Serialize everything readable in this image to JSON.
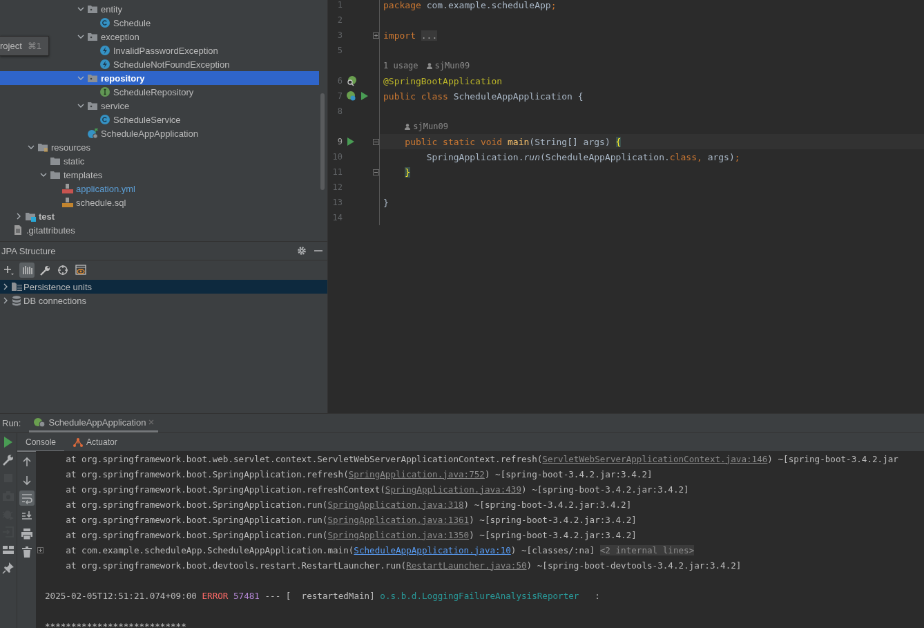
{
  "project_tree": {
    "tooltip": {
      "label": "roject",
      "shortcut": "⌘1"
    },
    "items": [
      {
        "children": [
          {
            "children": [
              {
                "children": [
                  {
                    "children": [
                      {
                        "children": [
                          {
                            "children": [
                              {
                                "label": "entity",
                                "kind": "package",
                                "expanded": true,
                                "selected": false,
                                "modified": false,
                                "children": [
                                  {
                                    "label": "Schedule",
                                    "kind": "class",
                                    "selected": false,
                                    "modified": false
                                  }
                                ]
                              },
                              {
                                "label": "exception",
                                "kind": "package",
                                "expanded": true,
                                "selected": false,
                                "modified": false,
                                "children": [
                                  {
                                    "label": "InvalidPasswordException",
                                    "kind": "exception",
                                    "selected": false,
                                    "modified": false
                                  },
                                  {
                                    "label": "ScheduleNotFoundException",
                                    "kind": "exception",
                                    "selected": false,
                                    "modified": false
                                  }
                                ]
                              },
                              {
                                "label": "repository",
                                "kind": "package",
                                "expanded": true,
                                "selected": true,
                                "modified": false,
                                "children": [
                                  {
                                    "label": "ScheduleRepository",
                                    "kind": "interface",
                                    "selected": false,
                                    "modified": false
                                  }
                                ]
                              },
                              {
                                "label": "service",
                                "kind": "package",
                                "expanded": true,
                                "selected": false,
                                "modified": false,
                                "children": [
                                  {
                                    "label": "ScheduleService",
                                    "kind": "class",
                                    "selected": false,
                                    "modified": false
                                  }
                                ]
                              },
                              {
                                "label": "ScheduleAppApplication",
                                "kind": "app",
                                "selected": false,
                                "modified": false
                              }
                            ]
                          }
                        ]
                      }
                    ]
                  }
                ]
              },
              {
                "label": "resources",
                "kind": "resources",
                "expanded": true,
                "selected": false,
                "modified": false,
                "children": [
                  {
                    "label": "static",
                    "kind": "folder",
                    "selected": false,
                    "modified": false
                  },
                  {
                    "label": "templates",
                    "kind": "folder",
                    "expanded": true,
                    "selected": false,
                    "modified": false,
                    "children": [
                      {
                        "label": "application.yml",
                        "kind": "yml",
                        "selected": false,
                        "modified": true
                      },
                      {
                        "label": "schedule.sql",
                        "kind": "sql",
                        "selected": false,
                        "modified": false
                      }
                    ]
                  }
                ]
              }
            ]
          },
          {
            "label": "test",
            "kind": "test-folder",
            "expanded": false,
            "selected": false,
            "modified": false
          }
        ]
      },
      {
        "label": ".gitattributes",
        "kind": "file",
        "selected": false,
        "modified": false
      }
    ]
  },
  "jpa_structure": {
    "title": "JPA Structure",
    "toolbar": [
      {
        "kind": "add",
        "on": false
      },
      {
        "kind": "columns",
        "on": true
      },
      {
        "kind": "wrench",
        "on": false
      },
      {
        "kind": "target",
        "on": false
      },
      {
        "kind": "preview",
        "on": false
      }
    ],
    "items": [
      {
        "label": "Persistence units",
        "kind": "persistence",
        "selected": true,
        "expanded": false
      },
      {
        "label": "DB connections",
        "kind": "database",
        "selected": false,
        "expanded": false
      }
    ]
  },
  "editor": {
    "lines": [
      {
        "kind": "code",
        "number": "1",
        "current": false,
        "tokens": [
          {
            "kind": "keyword",
            "text": "package"
          },
          {
            "kind": "plain",
            "text": " com.example.scheduleApp"
          },
          {
            "kind": "keyword",
            "text": ";"
          }
        ]
      },
      {
        "kind": "code",
        "number": "2",
        "current": false
      },
      {
        "kind": "code",
        "number": "3",
        "current": false,
        "fold": {
          "kind": "expand"
        },
        "tokens": [
          {
            "kind": "keyword",
            "text": "import"
          },
          {
            "kind": "folded",
            "text": " ..."
          }
        ]
      },
      {
        "kind": "code",
        "number": "5",
        "current": false
      },
      {
        "kind": "hint",
        "items": [
          {
            "kind": "usages",
            "text": "1 usage"
          },
          {
            "kind": "author",
            "text": "sjMun09"
          }
        ]
      },
      {
        "kind": "code",
        "number": "6",
        "current": false,
        "gutter": [
          {
            "kind": "bean-search"
          }
        ],
        "tokens": [
          {
            "kind": "annotation",
            "text": "@SpringBootApplication"
          }
        ]
      },
      {
        "kind": "code",
        "number": "7",
        "current": false,
        "gutter": [
          {
            "kind": "bean-run"
          },
          {
            "kind": "run"
          }
        ],
        "tokens": [
          {
            "kind": "keyword",
            "text": "public class"
          },
          {
            "kind": "plain",
            "text": " ScheduleAppApplication {"
          }
        ]
      },
      {
        "kind": "code",
        "number": "8",
        "current": false
      },
      {
        "kind": "hint",
        "items": [
          {
            "kind": "author",
            "text": "sjMun09"
          }
        ]
      },
      {
        "kind": "code",
        "number": "9",
        "current": true,
        "gutter": [
          {
            "kind": "run"
          }
        ],
        "fold": {
          "kind": "collapse"
        },
        "tokens": [
          {
            "kind": "keyword",
            "text": "    public static void"
          },
          {
            "kind": "method",
            "text": " main"
          },
          {
            "kind": "plain",
            "text": "(String[] args) "
          },
          {
            "kind": "brace",
            "text": "{"
          }
        ]
      },
      {
        "kind": "code",
        "number": "10",
        "current": false,
        "tokens": [
          {
            "kind": "plain",
            "text": "        SpringApplication."
          },
          {
            "kind": "italic",
            "text": "run"
          },
          {
            "kind": "plain",
            "text": "(ScheduleAppApplication."
          },
          {
            "kind": "keyword",
            "text": "class,"
          },
          {
            "kind": "plain",
            "text": " args)"
          },
          {
            "kind": "keyword",
            "text": ";"
          }
        ]
      },
      {
        "kind": "code",
        "number": "11",
        "current": false,
        "fold": {
          "kind": "collapse"
        },
        "tokens": [
          {
            "kind": "brace",
            "text": "    }"
          }
        ]
      },
      {
        "kind": "code",
        "number": "12",
        "current": false
      },
      {
        "kind": "code",
        "number": "13",
        "current": false,
        "tokens": [
          {
            "kind": "plain",
            "text": "}"
          }
        ]
      },
      {
        "kind": "code",
        "number": "14",
        "current": false
      }
    ]
  },
  "run_panel": {
    "label": "Run:",
    "tabs": [
      {
        "label": "ScheduleAppApplication",
        "selected": true
      }
    ],
    "side_tools": [
      {
        "kind": "run",
        "disabled": false
      },
      {
        "kind": "wrench",
        "disabled": false
      },
      {
        "kind": "stop",
        "disabled": true
      },
      {
        "kind": "camera",
        "disabled": true
      },
      {
        "kind": "debug",
        "disabled": true
      },
      {
        "kind": "exit",
        "disabled": true
      },
      {
        "kind": "layout",
        "disabled": false
      },
      {
        "kind": "pin",
        "disabled": false
      }
    ],
    "subtabs": [
      {
        "label": "Console",
        "kind": "console",
        "selected": true
      },
      {
        "label": "Actuator",
        "kind": "actuator",
        "selected": false
      }
    ],
    "console_tools": [
      {
        "kind": "up",
        "on": false
      },
      {
        "kind": "down",
        "on": false
      },
      {
        "kind": "wrap",
        "on": true
      },
      {
        "kind": "scroll-end",
        "on": false
      },
      {
        "kind": "print",
        "on": false
      },
      {
        "kind": "trash",
        "on": false
      }
    ],
    "lines": [
      {
        "fold": false,
        "segments": [
          {
            "kind": "plain",
            "text": "    at org.springframework.boot.web.servlet.context.ServletWebServerApplicationContext.refresh("
          },
          {
            "kind": "link",
            "text": "ServletWebServerApplicationContext.java:146"
          },
          {
            "kind": "plain",
            "text": ") ~[spring-boot-3.4.2.jar"
          }
        ]
      },
      {
        "fold": false,
        "segments": [
          {
            "kind": "plain",
            "text": "    at org.springframework.boot.SpringApplication.refresh("
          },
          {
            "kind": "link",
            "text": "SpringApplication.java:752"
          },
          {
            "kind": "plain",
            "text": ") ~[spring-boot-3.4.2.jar:3.4.2]"
          }
        ]
      },
      {
        "fold": false,
        "segments": [
          {
            "kind": "plain",
            "text": "    at org.springframework.boot.SpringApplication.refreshContext("
          },
          {
            "kind": "link",
            "text": "SpringApplication.java:439"
          },
          {
            "kind": "plain",
            "text": ") ~[spring-boot-3.4.2.jar:3.4.2]"
          }
        ]
      },
      {
        "fold": false,
        "segments": [
          {
            "kind": "plain",
            "text": "    at org.springframework.boot.SpringApplication.run("
          },
          {
            "kind": "link",
            "text": "SpringApplication.java:318"
          },
          {
            "kind": "plain",
            "text": ") ~[spring-boot-3.4.2.jar:3.4.2]"
          }
        ]
      },
      {
        "fold": false,
        "segments": [
          {
            "kind": "plain",
            "text": "    at org.springframework.boot.SpringApplication.run("
          },
          {
            "kind": "link",
            "text": "SpringApplication.java:1361"
          },
          {
            "kind": "plain",
            "text": ") ~[spring-boot-3.4.2.jar:3.4.2]"
          }
        ]
      },
      {
        "fold": false,
        "segments": [
          {
            "kind": "plain",
            "text": "    at org.springframework.boot.SpringApplication.run("
          },
          {
            "kind": "link",
            "text": "SpringApplication.java:1350"
          },
          {
            "kind": "plain",
            "text": ") ~[spring-boot-3.4.2.jar:3.4.2]"
          }
        ]
      },
      {
        "fold": true,
        "segments": [
          {
            "kind": "plain",
            "text": "    at com.example.scheduleApp.ScheduleAppApplication.main("
          },
          {
            "kind": "source-link",
            "text": "ScheduleAppApplication.java:10"
          },
          {
            "kind": "plain",
            "text": ") ~[classes/:na] "
          },
          {
            "kind": "hint",
            "text": "<2 internal lines>"
          }
        ]
      },
      {
        "fold": false,
        "segments": [
          {
            "kind": "plain",
            "text": "    at org.springframework.boot.devtools.restart.RestartLauncher.run("
          },
          {
            "kind": "link",
            "text": "RestartLauncher.java:50"
          },
          {
            "kind": "plain",
            "text": ") ~[spring-boot-devtools-3.4.2.jar:3.4.2]"
          }
        ]
      },
      {
        "fold": false
      },
      {
        "fold": false,
        "segments": [
          {
            "kind": "plain",
            "text": "2025-02-05T12:51:21.074+09:00 "
          },
          {
            "kind": "error",
            "text": "ERROR"
          },
          {
            "kind": "pid",
            "text": " 57481"
          },
          {
            "kind": "plain",
            "text": " --- [  restartedMain] "
          },
          {
            "kind": "logger",
            "text": "o.s.b.d.LoggingFailureAnalysisReporter"
          },
          {
            "kind": "plain",
            "text": "   :"
          }
        ]
      },
      {
        "fold": false
      },
      {
        "fold": false,
        "segments": [
          {
            "kind": "plain",
            "text": "***************************"
          }
        ]
      }
    ]
  }
}
